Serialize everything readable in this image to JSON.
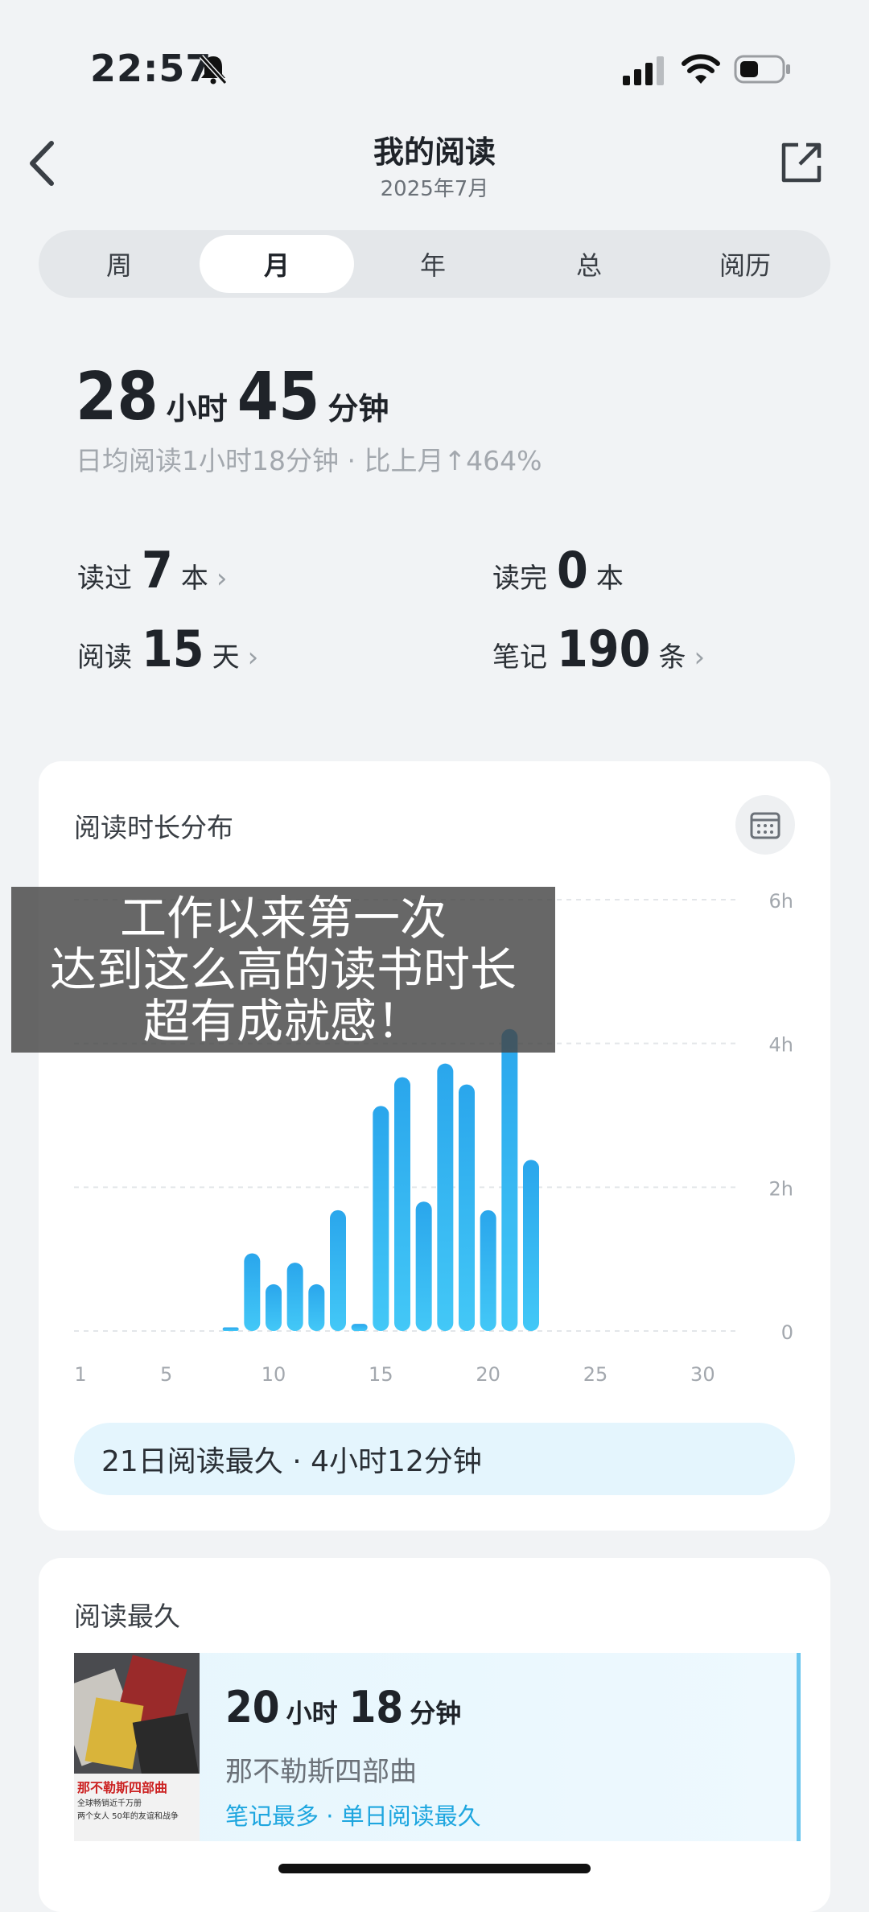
{
  "status_bar": {
    "time": "22:57"
  },
  "header": {
    "title": "我的阅读",
    "subtitle": "2025年7月"
  },
  "tabs": [
    {
      "label": "周",
      "active": false
    },
    {
      "label": "月",
      "active": true
    },
    {
      "label": "年",
      "active": false
    },
    {
      "label": "总",
      "active": false
    },
    {
      "label": "阅历",
      "active": false
    }
  ],
  "total": {
    "hours": "28",
    "hours_unit": "小时",
    "minutes": "45",
    "minutes_unit": "分钟",
    "subtitle": "日均阅读1小时18分钟 · 比上月↑464%"
  },
  "stats": {
    "read": {
      "label": "读过",
      "value": "7",
      "unit": "本"
    },
    "finished": {
      "label": "读完",
      "value": "0",
      "unit": "本"
    },
    "days": {
      "label": "阅读",
      "value": "15",
      "unit": "天"
    },
    "notes": {
      "label": "笔记",
      "value": "190",
      "unit": "条"
    }
  },
  "distribution": {
    "title": "阅读时长分布",
    "summary": "21日阅读最久 · 4小时12分钟"
  },
  "overlay_caption": {
    "line1": "工作以来第一次",
    "line2": "达到这么高的读书时长",
    "line3": "超有成就感！"
  },
  "chart_data": {
    "type": "bar",
    "x": [
      8,
      9,
      10,
      11,
      12,
      13,
      14,
      15,
      16,
      17,
      18,
      19,
      20,
      21,
      22
    ],
    "values": [
      0.05,
      1.08,
      0.65,
      0.95,
      0.65,
      1.68,
      0.1,
      3.13,
      3.53,
      1.8,
      3.72,
      3.43,
      1.68,
      4.2,
      2.38
    ],
    "xticks": [
      "1",
      "5",
      "10",
      "15",
      "20",
      "25",
      "30"
    ],
    "yticks": [
      "0",
      "2h",
      "4h",
      "6h"
    ],
    "xlim": [
      1,
      31
    ],
    "ylim": [
      0,
      6
    ],
    "color": "#2fb3f0"
  },
  "longest": {
    "title": "阅读最久",
    "hours": "20",
    "hours_unit": "小时",
    "minutes": "18",
    "minutes_unit": "分钟",
    "book_name": "那不勒斯四部曲",
    "tags": "笔记最多 · 单日阅读最久",
    "cover": {
      "title": "那不勒斯四部曲",
      "line1": "全球畅销近千万册",
      "line2": "两个女人 50年的友谊和战争"
    }
  }
}
